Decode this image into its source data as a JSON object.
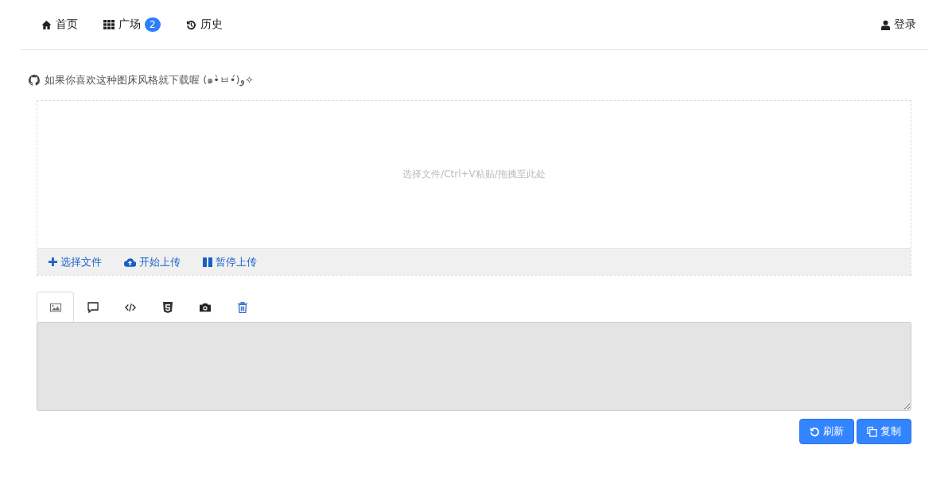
{
  "nav": {
    "items": [
      {
        "kind": "home",
        "label": "首页"
      },
      {
        "kind": "grid",
        "label": "广场",
        "badge": "2"
      },
      {
        "kind": "history",
        "label": "历史"
      }
    ],
    "login": {
      "label": "登录"
    }
  },
  "notice": "如果你喜欢这种图床风格就下载喔 (๑•̀ㅂ•́)و✧",
  "dropzone": {
    "hint": "选择文件/Ctrl+V粘贴/拖拽至此处"
  },
  "actions": [
    {
      "kind": "add",
      "label": "选择文件"
    },
    {
      "kind": "upload",
      "label": "开始上传"
    },
    {
      "kind": "pause",
      "label": "暂停上传"
    }
  ],
  "tabs": [
    {
      "kind": "image",
      "selected": true
    },
    {
      "kind": "comment",
      "selected": false
    },
    {
      "kind": "code",
      "selected": false
    },
    {
      "kind": "html5",
      "selected": false
    },
    {
      "kind": "camera",
      "selected": false
    },
    {
      "kind": "trash",
      "selected": false
    }
  ],
  "output": {
    "disabled": true
  },
  "buttons": [
    {
      "kind": "refresh",
      "label": "刷新"
    },
    {
      "kind": "copy",
      "label": "复制"
    }
  ]
}
